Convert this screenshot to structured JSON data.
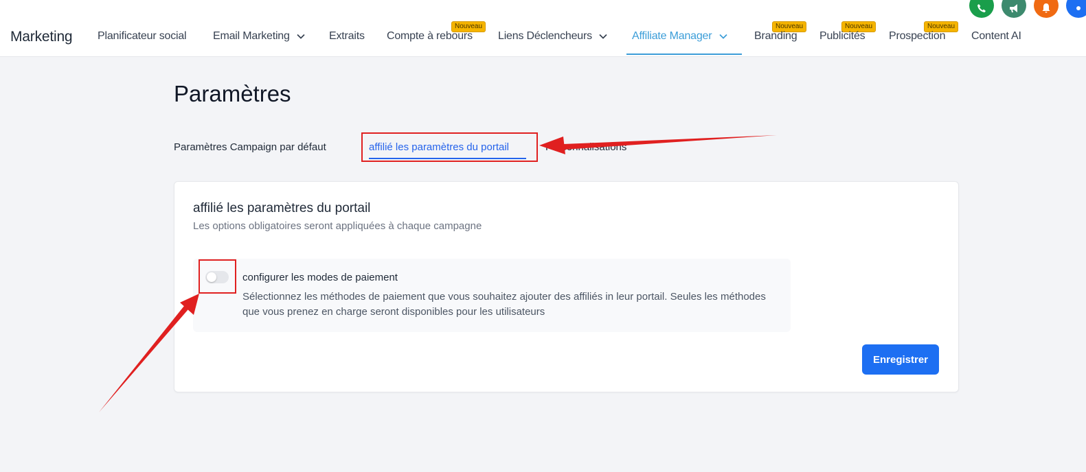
{
  "header": {
    "brand": "Marketing",
    "nav": [
      {
        "label": "Planificateur social"
      },
      {
        "label": "Email Marketing",
        "has_dropdown": true
      },
      {
        "label": "Extraits"
      },
      {
        "label": "Compte à rebours",
        "badge": "Nouveau"
      },
      {
        "label": "Liens Déclencheurs",
        "has_dropdown": true
      },
      {
        "label": "Affiliate Manager",
        "has_dropdown": true,
        "active": true
      },
      {
        "label": "Branding",
        "badge": "Nouveau"
      },
      {
        "label": "Publicités",
        "badge": "Nouveau"
      },
      {
        "label": "Prospection",
        "badge": "Nouveau"
      },
      {
        "label": "Content AI"
      }
    ],
    "action_icons": [
      {
        "name": "phone-icon",
        "color": "#1a9e4b"
      },
      {
        "name": "megaphone-icon",
        "color": "#3d8a6e"
      },
      {
        "name": "bell-icon",
        "color": "#f06a12"
      },
      {
        "name": "help-icon",
        "color": "#1d6ff2"
      }
    ]
  },
  "page": {
    "title": "Paramètres",
    "tabs": [
      {
        "label": "Paramètres Campaign par défaut"
      },
      {
        "label": "affilié les paramètres du portail",
        "active": true
      },
      {
        "label": "Personnalisations"
      }
    ]
  },
  "card": {
    "title": "affilié les paramètres du portail",
    "subtitle": "Les options obligatoires seront appliquées à chaque campagne",
    "option": {
      "title": "configurer les modes de paiement",
      "description": "Sélectionnez les méthodes de paiement que vous souhaitez ajouter des affiliés in leur portail. Seules les méthodes que vous prenez en charge seront disponibles pour les utilisateurs",
      "enabled": false
    },
    "save_label": "Enregistrer"
  },
  "colors": {
    "accent": "#3b9dd8",
    "tab_active": "#2563eb",
    "primary_button": "#1d6ff2",
    "badge": "#f5b400",
    "annotation": "#e02020"
  }
}
